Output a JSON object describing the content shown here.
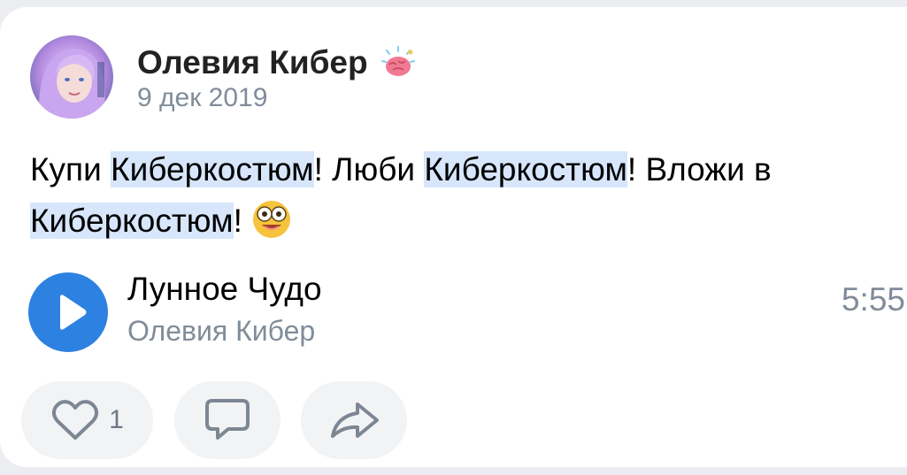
{
  "post": {
    "author": {
      "name": "Олевия Кибер",
      "name_icon": "brain-emoji-icon",
      "avatar_icon": "user-avatar"
    },
    "date": "9 дек 2019",
    "text": {
      "seg1": "Купи ",
      "tag": "Киберкостюм",
      "seg2": "! Люби ",
      "seg3": "! Вложи в ",
      "seg4": "!",
      "emoji": "star-struck-face-icon"
    },
    "audio": {
      "title": "Лунное Чудо",
      "artist": "Олевия Кибер",
      "duration": "5:55",
      "play_icon": "play-icon"
    },
    "actions": {
      "like_count": "1",
      "like_icon": "heart-icon",
      "comment_icon": "comment-icon",
      "share_icon": "share-icon"
    }
  },
  "colors": {
    "accent": "#2d81e0",
    "secondary_text": "#818c99",
    "highlight": "#d7e6fb",
    "pill_bg": "#f2f3f5",
    "page_bg": "#ebedf0"
  }
}
